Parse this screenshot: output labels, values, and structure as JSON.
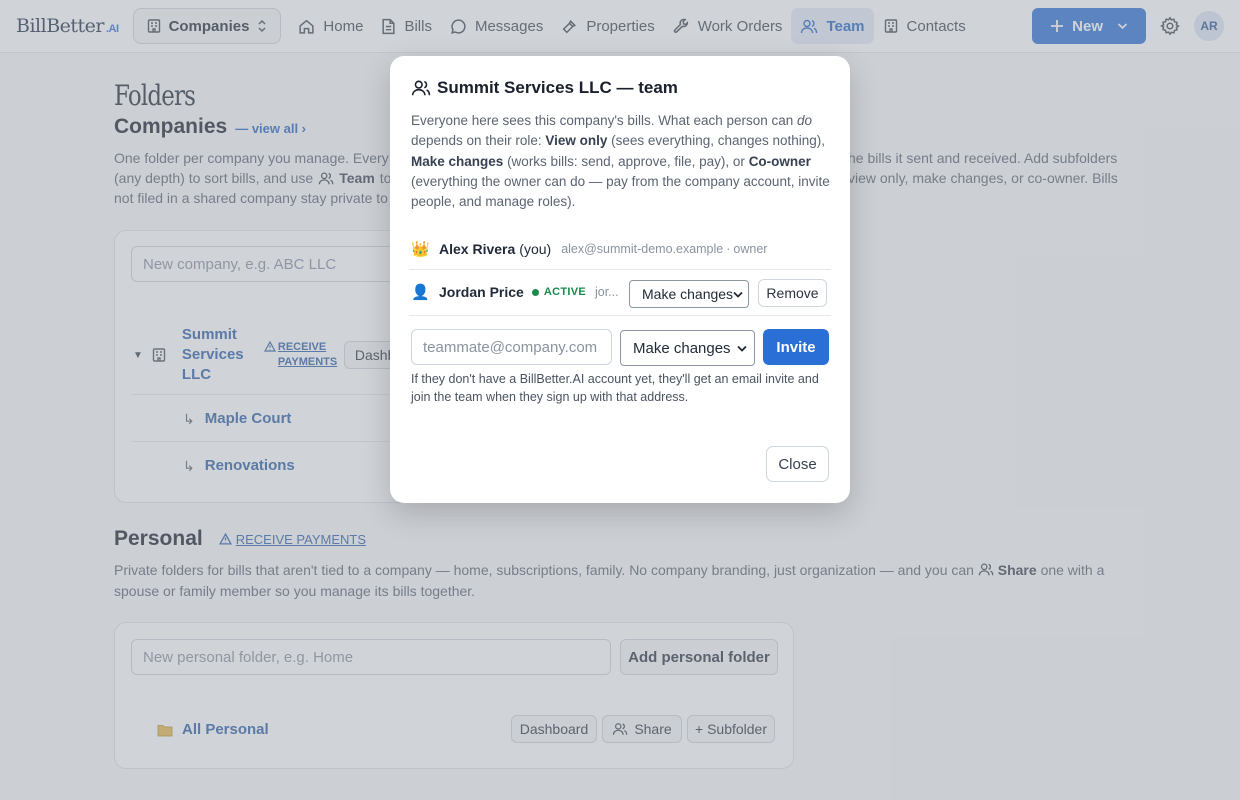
{
  "brand": {
    "name": "BillBetter",
    "suffix": ".AI"
  },
  "nav": {
    "company_switcher": "Companies",
    "links": [
      {
        "label": "Home",
        "icon": "home-icon"
      },
      {
        "label": "Bills",
        "icon": "document-icon"
      },
      {
        "label": "Messages",
        "icon": "chat-icon"
      },
      {
        "label": "Properties",
        "icon": "hammer-icon"
      },
      {
        "label": "Work Orders",
        "icon": "wrench-icon"
      },
      {
        "label": "Team",
        "icon": "people-icon",
        "active": true
      },
      {
        "label": "Contacts",
        "icon": "building-icon"
      }
    ],
    "new_label": "New",
    "avatar_initials": "AR"
  },
  "page": {
    "title": "Folders",
    "companies": {
      "heading": "Companies",
      "view_all": "— view all ›",
      "desc_1": "One folder per company you manage. Every",
      "desc_1b": "he bills it sent and received. Add subfolders",
      "desc_2": "(any depth) to sort bills, and use",
      "desc_2_team": "Team",
      "desc_2b": "to",
      "desc_2c": "view only, make changes, or co-owner. Bills",
      "desc_3": "not filed in a shared company stay private to",
      "input_placeholder": "New company, e.g. ABC LLC",
      "folder": {
        "name": "Summit Services LLC",
        "receive_payments": "RECEIVE PAYMENTS",
        "dashboard": "Dashbo"
      },
      "subfolders": [
        "Maple Court",
        "Renovations"
      ],
      "sub_arrow": "↳"
    },
    "personal": {
      "heading": "Personal",
      "receive_payments": "RECEIVE PAYMENTS",
      "desc": "Private folders for bills that aren't tied to a company — home, subscriptions, family. No company branding, just organization — and you can",
      "desc_share": "Share",
      "desc_end": "one with a spouse or family member so you manage its bills together.",
      "input_placeholder": "New personal folder, e.g. Home",
      "add_button": "Add personal folder",
      "folder": {
        "name": "All Personal",
        "dashboard": "Dashboard",
        "share": "Share",
        "subfolder": "+ Subfolder"
      }
    }
  },
  "modal": {
    "title": "Summit Services LLC — team",
    "desc_a": "Everyone here sees this company's bills. What each person can",
    "desc_do": "do",
    "desc_b": "depends on their role:",
    "role_view": "View only",
    "desc_c": "(sees everything, changes nothing),",
    "role_make": "Make changes",
    "desc_d": "(works bills: send, approve, file, pay), or",
    "role_co": "Co-owner",
    "desc_e": "(everything the owner can do — pay from the company account, invite people, and manage roles).",
    "owner": {
      "emoji": "👑",
      "name": "Alex Rivera",
      "you": "(you)",
      "email": "alex@summit-demo.example",
      "role": "owner"
    },
    "member": {
      "emoji": "👤",
      "name": "Jordan Price",
      "status": "ACTIVE",
      "email_truncated": "jor...",
      "role": "Make changes",
      "remove": "Remove"
    },
    "invite_placeholder": "teammate@company.com",
    "invite_role": "Make changes",
    "invite_button": "Invite",
    "note": "If they don't have a BillBetter.AI account yet, they'll get an email invite and join the team when they sign up with that address.",
    "close": "Close"
  },
  "colors": {
    "accent": "#2a6fd6",
    "link": "#2b5ea7",
    "active_status": "#1b8a4a"
  }
}
